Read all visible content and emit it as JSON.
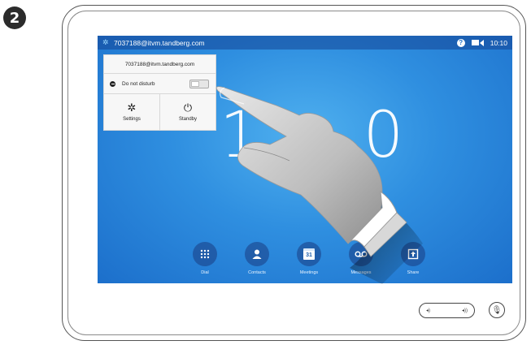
{
  "step": {
    "number": "2"
  },
  "status_bar": {
    "address": "7037188@itvm.tandberg.com",
    "time": "10:10",
    "icons": [
      "gear-icon",
      "help-icon",
      "video-icon"
    ]
  },
  "popup": {
    "title": "7037188@itvm.tandberg.com",
    "do_not_disturb_label": "Do not disturb",
    "do_not_disturb_on": false,
    "settings_label": "Settings",
    "standby_label": "Standby"
  },
  "clock": {
    "partial_left": "1",
    "partial_right": "0"
  },
  "dock": [
    {
      "label": "Dial",
      "icon": "dialpad-icon"
    },
    {
      "label": "Contacts",
      "icon": "person-icon"
    },
    {
      "label": "Meetings",
      "icon": "calendar-icon",
      "calendar_day": "31"
    },
    {
      "label": "Messages",
      "icon": "voicemail-icon"
    },
    {
      "label": "Share",
      "icon": "share-icon"
    }
  ],
  "controls": {
    "volume": "volume-control",
    "mute": "mute-mic-icon"
  },
  "colors": {
    "screen": "#2f8fe0",
    "accent": "#1e6fc8"
  }
}
